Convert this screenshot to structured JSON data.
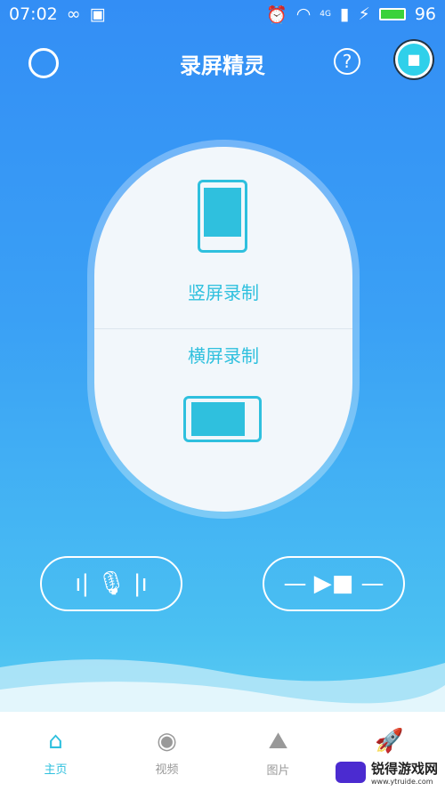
{
  "status": {
    "time": "07:02",
    "battery": "96",
    "network": "4G"
  },
  "header": {
    "title": "录屏精灵",
    "help": "?"
  },
  "card": {
    "portrait": "竖屏录制",
    "landscape": "横屏录制"
  },
  "tabs": [
    {
      "label": "主页",
      "icon": "home-icon",
      "active": true
    },
    {
      "label": "视频",
      "icon": "play-circle-icon"
    },
    {
      "label": "图片",
      "icon": "image-icon"
    },
    {
      "label": "",
      "icon": "rocket-icon"
    }
  ],
  "watermark": {
    "name": "锐得游戏网",
    "url": "www.ytruide.com"
  },
  "colors": {
    "accent": "#2fc0de",
    "bg": "#338ef5"
  }
}
